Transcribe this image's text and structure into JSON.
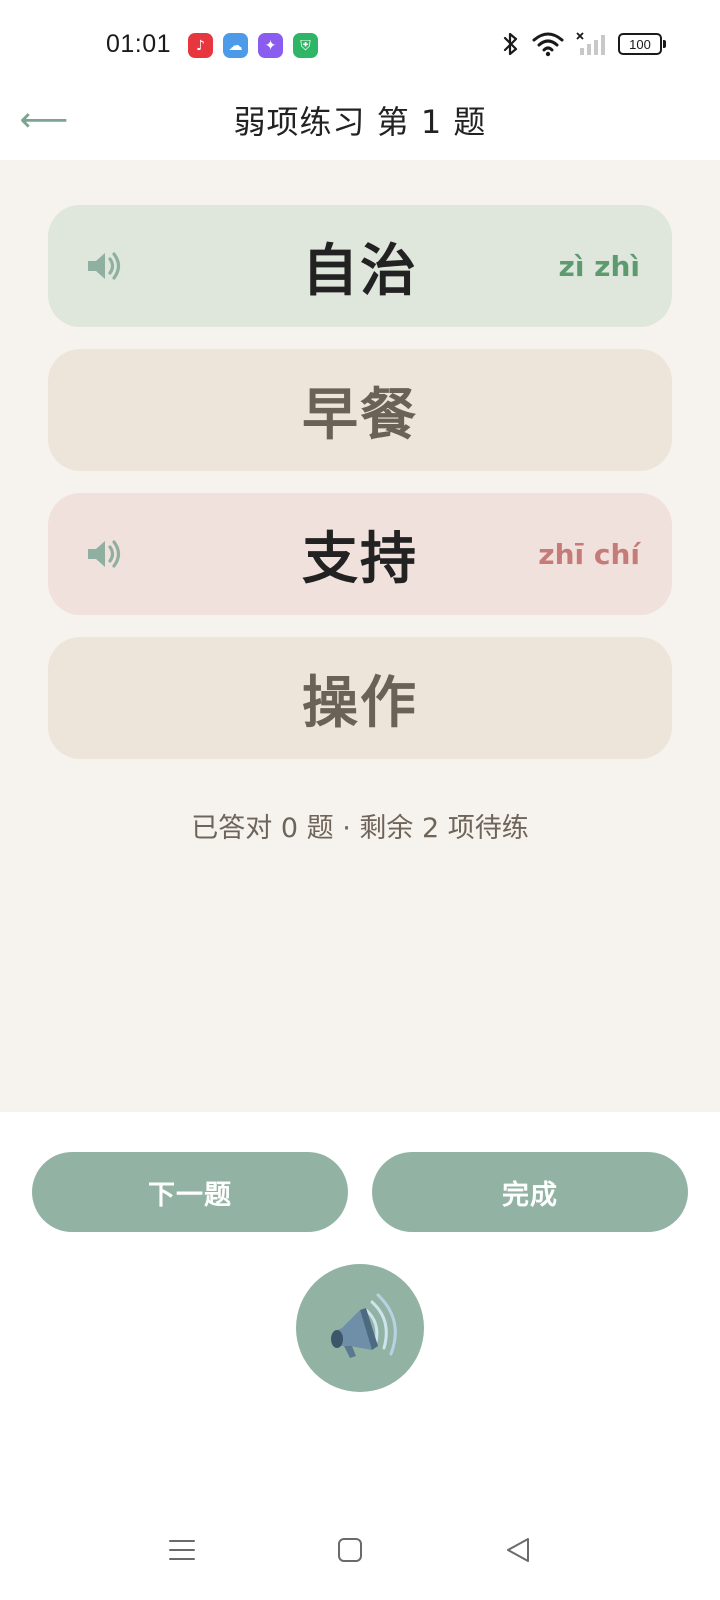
{
  "status_bar": {
    "time": "01:01",
    "battery": "100",
    "app_icons": [
      {
        "name": "music-app-icon",
        "glyph": "♪",
        "color": "#e8363f"
      },
      {
        "name": "weather-app-icon",
        "glyph": "☁",
        "color": "#4d9be8"
      },
      {
        "name": "photos-app-icon",
        "glyph": "✦",
        "color": "#8a5cf0"
      },
      {
        "name": "security-app-icon",
        "glyph": "⛨",
        "color": "#2fb566"
      }
    ]
  },
  "header": {
    "back_glyph": "⟵",
    "title": "弱项练习  第 1 题"
  },
  "options": [
    {
      "word": "自治",
      "pinyin": "zì zhì",
      "state": "correct"
    },
    {
      "word": "早餐",
      "pinyin": "",
      "state": "neutral"
    },
    {
      "word": "支持",
      "pinyin": "zhī chí",
      "state": "wrong"
    },
    {
      "word": "操作",
      "pinyin": "",
      "state": "neutral"
    }
  ],
  "progress_text": "已答对 0 题 · 剩余 2 项待练",
  "buttons": {
    "next_label": "下一题",
    "finish_label": "完成"
  },
  "colors": {
    "accent": "#92b3a3",
    "correct_bg": "#dfe6db",
    "wrong_bg": "#f1e1dc",
    "neutral_bg": "#ede5da",
    "content_bg": "#f6f3ee"
  }
}
